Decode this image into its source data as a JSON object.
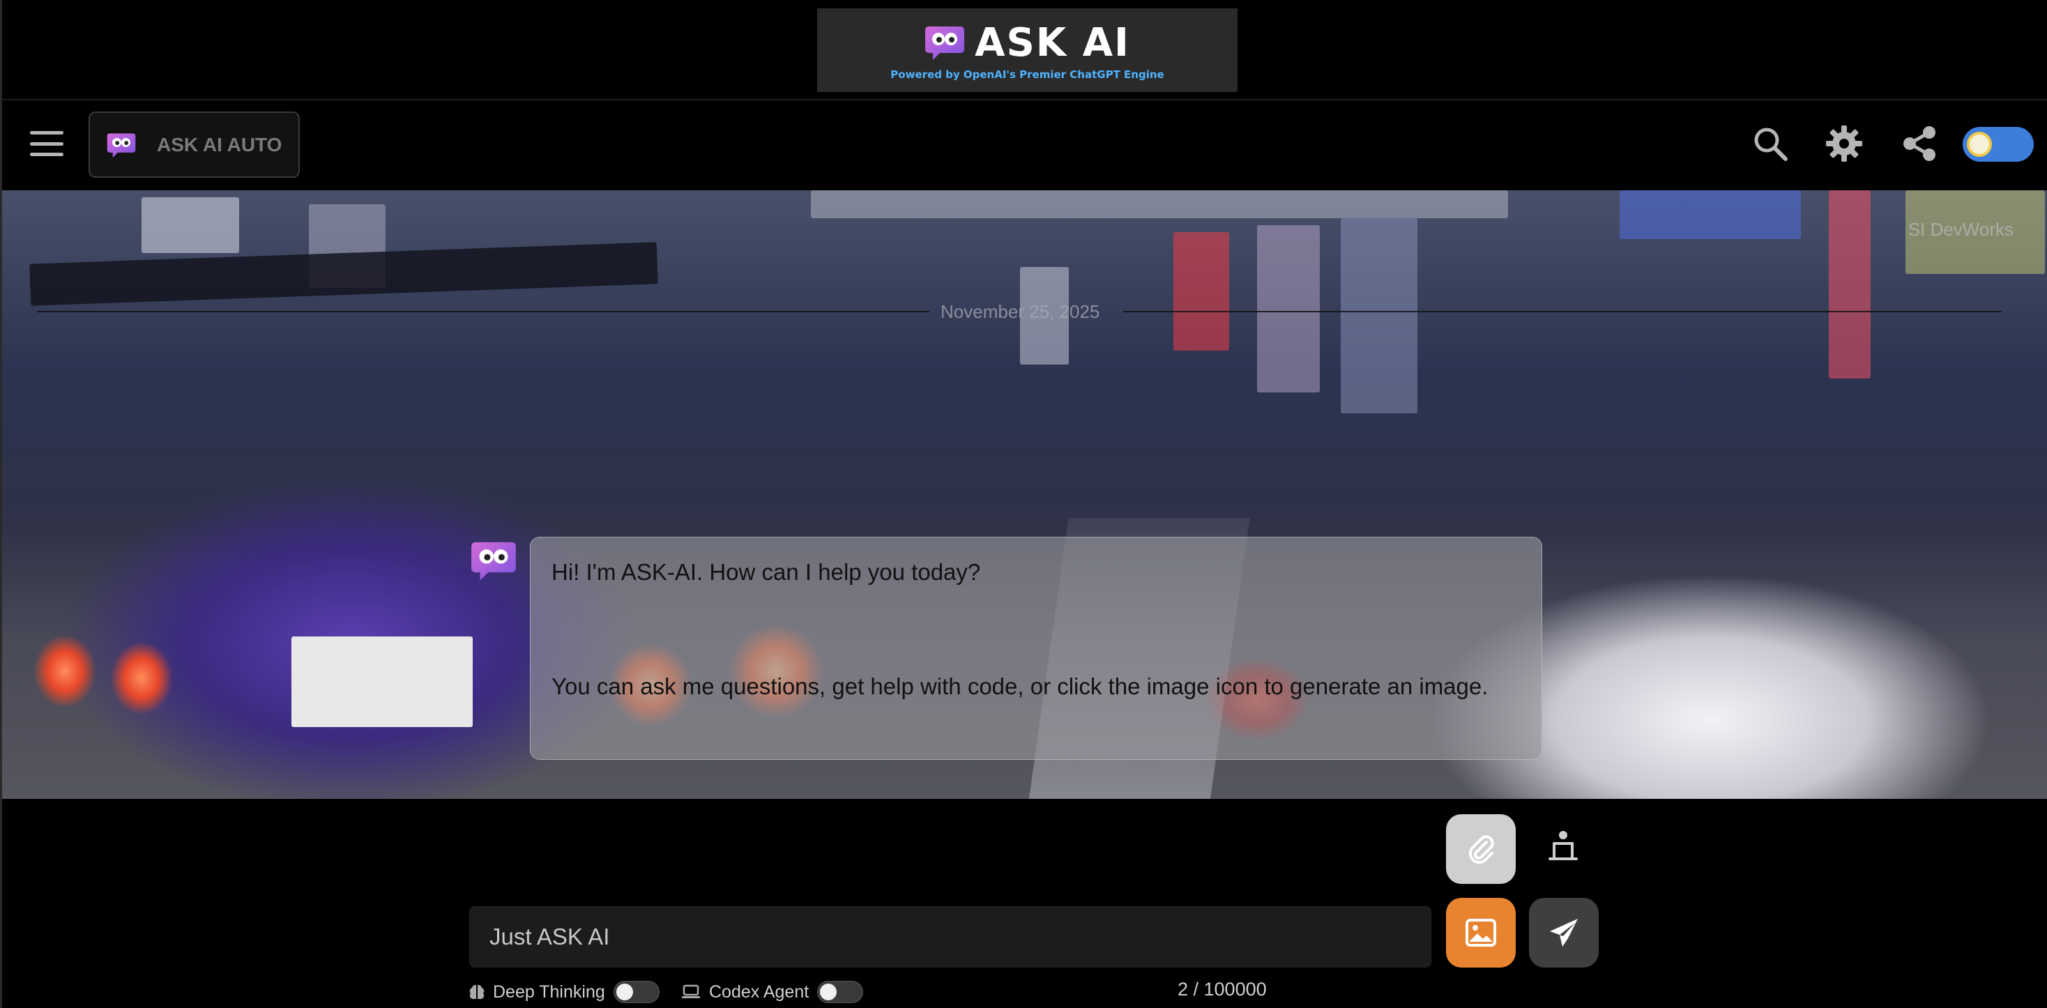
{
  "banner": {
    "title": "ASK AI",
    "subtitle": "Powered by OpenAI's Premier ChatGPT Engine"
  },
  "header": {
    "model_label": "ASK AI AUTO",
    "icons": [
      "menu-icon",
      "search-icon",
      "gear-icon",
      "share-icon",
      "theme-toggle"
    ]
  },
  "chat": {
    "watermark": "SI DevWorks",
    "date": "November 25, 2025",
    "message_line_1": "Hi! I'm ASK-AI. How can I help you today?",
    "message_line_2": "You can ask me questions, get help with code, or click the image icon to generate an image."
  },
  "composer": {
    "placeholder": "Just ASK AI",
    "deep_thinking_label": "Deep Thinking",
    "codex_agent_label": "Codex Agent",
    "deep_thinking_on": false,
    "codex_agent_on": false,
    "counter": "2 / 100000"
  },
  "colors": {
    "accent_orange": "#e8832f",
    "toggle_blue": "#3d7ddb",
    "subtitle_blue": "#4fb3ff"
  }
}
